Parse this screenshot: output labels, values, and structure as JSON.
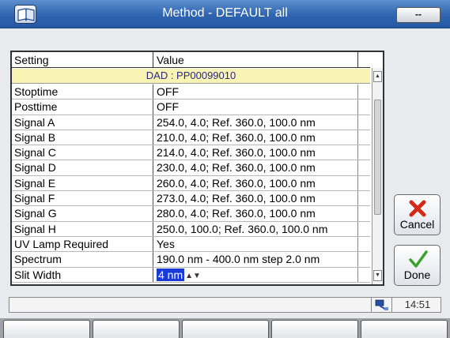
{
  "window": {
    "title": "Method - DEFAULT all",
    "menu_button_label": "--"
  },
  "table": {
    "headers": {
      "setting": "Setting",
      "value": "Value"
    },
    "section": "DAD : PP00099010",
    "rows": [
      {
        "setting": "Stoptime",
        "value": "OFF"
      },
      {
        "setting": "Posttime",
        "value": "OFF"
      },
      {
        "setting": "Signal A",
        "value": "254.0, 4.0; Ref. 360.0, 100.0 nm"
      },
      {
        "setting": "Signal B",
        "value": "210.0, 4.0; Ref. 360.0, 100.0 nm"
      },
      {
        "setting": "Signal C",
        "value": "214.0, 4.0; Ref. 360.0, 100.0 nm"
      },
      {
        "setting": "Signal D",
        "value": "230.0, 4.0; Ref. 360.0, 100.0 nm"
      },
      {
        "setting": "Signal E",
        "value": "260.0, 4.0; Ref. 360.0, 100.0 nm"
      },
      {
        "setting": "Signal F",
        "value": "273.0, 4.0; Ref. 360.0, 100.0 nm"
      },
      {
        "setting": "Signal G",
        "value": "280.0, 4.0; Ref. 360.0, 100.0 nm"
      },
      {
        "setting": "Signal H",
        "value": "250.0, 100.0; Ref. 360.0, 100.0 nm"
      },
      {
        "setting": "UV Lamp Required",
        "value": "Yes"
      },
      {
        "setting": "Spectrum",
        "value": "190.0 nm - 400.0 nm step 2.0 nm"
      },
      {
        "setting": "Slit Width",
        "value": "4 nm"
      }
    ]
  },
  "buttons": {
    "cancel": "Cancel",
    "done": "Done"
  },
  "status": {
    "time": "14:51"
  },
  "icons": {
    "app": "book-icon",
    "cancel": "red-x-icon",
    "done": "green-check-icon",
    "status": "network-icon"
  },
  "colors": {
    "titlebar": "#2e64b0",
    "section_bg": "#f9f3b4",
    "selection": "#1a3bd8"
  }
}
